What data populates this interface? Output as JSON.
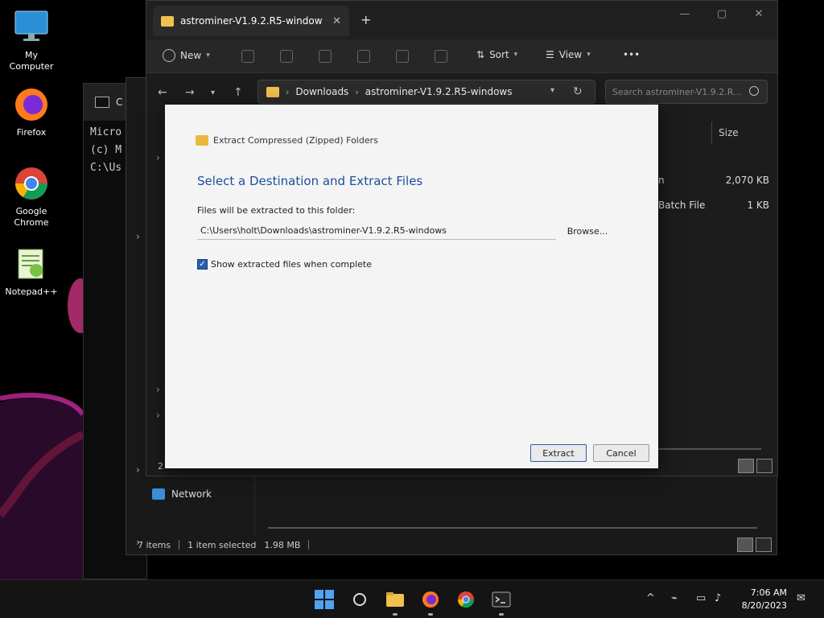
{
  "desktop": {
    "icons": [
      {
        "label": "My Computer",
        "icon": "monitor-icon"
      },
      {
        "label": "Firefox",
        "icon": "firefox-icon"
      },
      {
        "label": "Google Chrome",
        "icon": "chrome-icon"
      },
      {
        "label": "Notepad++",
        "icon": "notepadpp-icon"
      }
    ]
  },
  "terminal": {
    "tab_title": "C",
    "lines": [
      "Micro",
      "(c) M",
      "",
      "C:\\Us"
    ]
  },
  "explorer_back": {
    "status_items": "7 items",
    "status_selected": "1 item selected",
    "status_size": "1.98 MB",
    "network_label": "Network"
  },
  "explorer": {
    "tab_title": "astrominer-V1.9.2.R5-window",
    "close_glyph": "✕",
    "new_tab_glyph": "+",
    "window_controls": [
      "—",
      "▢",
      "✕"
    ],
    "commands": {
      "new": "New",
      "sort": "Sort",
      "view": "View",
      "more": "•••"
    },
    "breadcrumb": [
      "Downloads",
      "astrominer-V1.9.2.R5-windows"
    ],
    "search_placeholder": "Search astrominer-V1.9.2.R...",
    "column_size": "Size",
    "files": [
      {
        "name": "n",
        "size": "2,070 KB"
      },
      {
        "name": "Batch File",
        "size": "1 KB"
      }
    ],
    "status_count": "2"
  },
  "dialog": {
    "header": "Extract Compressed (Zipped) Folders",
    "heading": "Select a Destination and Extract Files",
    "label": "Files will be extracted to this folder:",
    "path": "C:\\Users\\holt\\Downloads\\astrominer-V1.9.2.R5-windows",
    "browse": "Browse...",
    "checkbox_label": "Show extracted files when complete",
    "checkbox_checked": true,
    "extract_button": "Extract",
    "cancel_button": "Cancel"
  },
  "taskbar": {
    "time": "7:06 AM",
    "date": "8/20/2023"
  },
  "colors": {
    "accent": "#2a5fb0",
    "folder": "#f1c04d",
    "taskbar": "#141414"
  }
}
